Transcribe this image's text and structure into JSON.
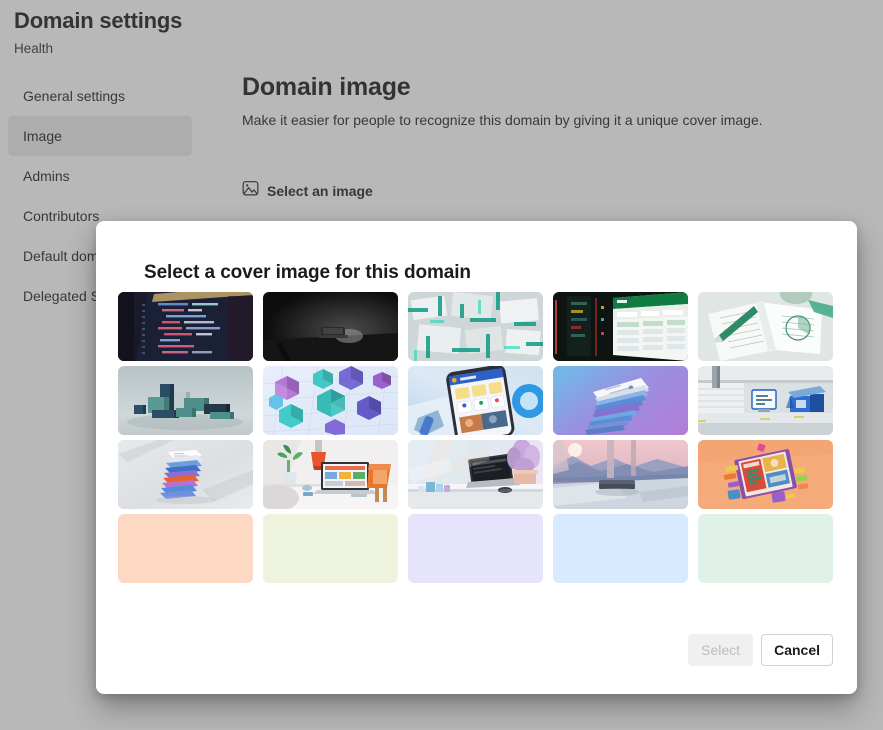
{
  "background_page": {
    "title": "Domain settings",
    "breadcrumb": "Health",
    "sidebar": {
      "items": [
        {
          "label": "General settings",
          "selected": false
        },
        {
          "label": "Image",
          "selected": true
        },
        {
          "label": "Admins",
          "selected": false
        },
        {
          "label": "Contributors",
          "selected": false
        },
        {
          "label": "Default domain image",
          "selected": false
        },
        {
          "label": "Delegated Settings",
          "selected": false
        }
      ]
    },
    "content": {
      "heading": "Domain image",
      "description": "Make it easier for people to recognize this domain by giving it a unique cover image.",
      "select_image_button": {
        "label": "Select an image",
        "icon": "image-picture-icon"
      }
    }
  },
  "dialog": {
    "title": "Select a cover image for this domain",
    "images": [
      {
        "id": "code-editor-dark",
        "alt": "Dark code editor on laptop screen",
        "kind": "photo"
      },
      {
        "id": "dark-desk-laptop",
        "alt": "Laptop glowing on a dark desk",
        "kind": "photo"
      },
      {
        "id": "teal-spreadsheet-abstract",
        "alt": "Abstract teal spreadsheet grid pattern",
        "kind": "photo"
      },
      {
        "id": "excel-green-screens",
        "alt": "Green Excel spreadsheet on dark screens",
        "kind": "photo"
      },
      {
        "id": "notebook-green-pen",
        "alt": "Open notebook with pen and charts",
        "kind": "photo"
      },
      {
        "id": "teal-blocks-3d",
        "alt": "3D teal and navy blocks on grey",
        "kind": "illustration"
      },
      {
        "id": "purple-glass-cubes",
        "alt": "Purple and teal glass cubes on light grid",
        "kind": "illustration"
      },
      {
        "id": "phone-app-blue",
        "alt": "Phone showing app with blue ring",
        "kind": "illustration"
      },
      {
        "id": "stacked-cards-purple",
        "alt": "Stacked documents on purple gradient",
        "kind": "illustration"
      },
      {
        "id": "office-desk-blue",
        "alt": "Blue office desk with monitor",
        "kind": "illustration"
      },
      {
        "id": "paper-stack-colorful",
        "alt": "Colorful stack of papers on grey",
        "kind": "illustration"
      },
      {
        "id": "home-office-desk",
        "alt": "Home office desk with laptop and plant",
        "kind": "illustration"
      },
      {
        "id": "laptop-lavender-plant",
        "alt": "Laptop beside lavender plant on shelf",
        "kind": "illustration"
      },
      {
        "id": "sunset-landscape-desk",
        "alt": "Desk overlooking pink sunset landscape",
        "kind": "illustration"
      },
      {
        "id": "orange-workspace-flatlay",
        "alt": "Orange flat-lay of a tablet workspace",
        "kind": "illustration"
      },
      {
        "id": "solid-peach",
        "alt": "Solid peach color",
        "kind": "color",
        "color": "#fdd8c3"
      },
      {
        "id": "solid-light-green",
        "alt": "Solid light green color",
        "kind": "color",
        "color": "#edf3dd"
      },
      {
        "id": "solid-lavender",
        "alt": "Solid lavender color",
        "kind": "color",
        "color": "#e6e4fc"
      },
      {
        "id": "solid-light-blue",
        "alt": "Solid light blue color",
        "kind": "color",
        "color": "#d7eaff"
      },
      {
        "id": "solid-mint",
        "alt": "Solid mint color",
        "kind": "color",
        "color": "#e0f2e8"
      }
    ],
    "buttons": {
      "select": {
        "label": "Select",
        "disabled": true
      },
      "cancel": {
        "label": "Cancel",
        "disabled": false
      }
    }
  },
  "colors": {
    "dialog_background": "#ffffff",
    "overlay": "#aaaaaa",
    "sidebar_selected": "#ededed",
    "text_primary": "#1b1b1b",
    "text_secondary": "#242424",
    "button_disabled_text": "#bdbdbd",
    "button_border": "#d1d1d1"
  }
}
